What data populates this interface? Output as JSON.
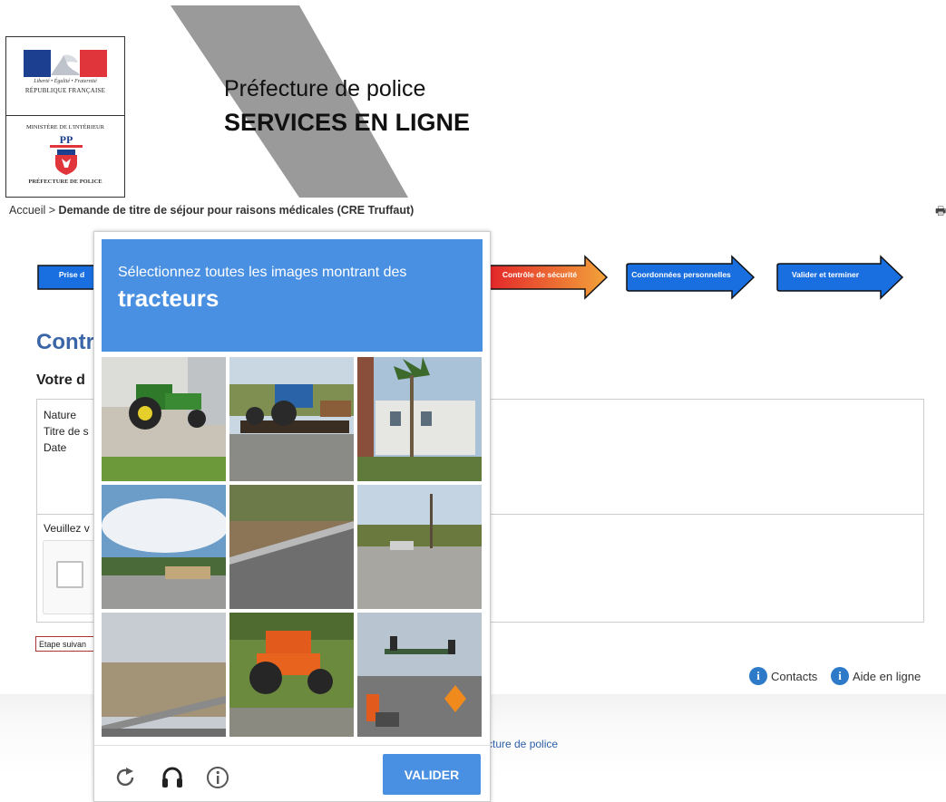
{
  "header": {
    "logo_motto": "Liberté • Égalité • Fraternité",
    "logo_republique": "RÉPUBLIQUE FRANÇAISE",
    "logo_ministere": "MINISTÈRE DE L'INTÉRIEUR",
    "logo_prefecture": "PRÉFECTURE DE POLICE",
    "title_line1": "Préfecture de police",
    "title_line2": "SERVICES EN LIGNE"
  },
  "breadcrumb": {
    "home": "Accueil",
    "separator": " > ",
    "current": "Demande de titre de séjour pour raisons médicales (CRE Truffaut)"
  },
  "steps": [
    {
      "label": "Prise d",
      "color": "#1a6fe0"
    },
    {
      "label": "Contrôle de sécurité",
      "color": "#e8401a"
    },
    {
      "label": "Coordonnées personnelles",
      "color": "#1a6fe0"
    },
    {
      "label": "Valider et terminer",
      "color": "#1a6fe0"
    }
  ],
  "main": {
    "heading": "Contr",
    "subheading": "Votre d",
    "labels": [
      "Nature",
      "Titre de s",
      "Date"
    ],
    "verify_text": "Veuillez v",
    "next_button": "Etape suivan"
  },
  "links": {
    "contacts": "Contacts",
    "help": "Aide en ligne"
  },
  "footer": {
    "text": "cture de police"
  },
  "captcha": {
    "instruction": "Sélectionnez toutes les images montrant des",
    "keyword": "tracteurs",
    "verify_button": "VALIDER",
    "icons": [
      "reload-icon",
      "audio-icon",
      "info-icon"
    ],
    "header_color": "#4a90e2"
  }
}
